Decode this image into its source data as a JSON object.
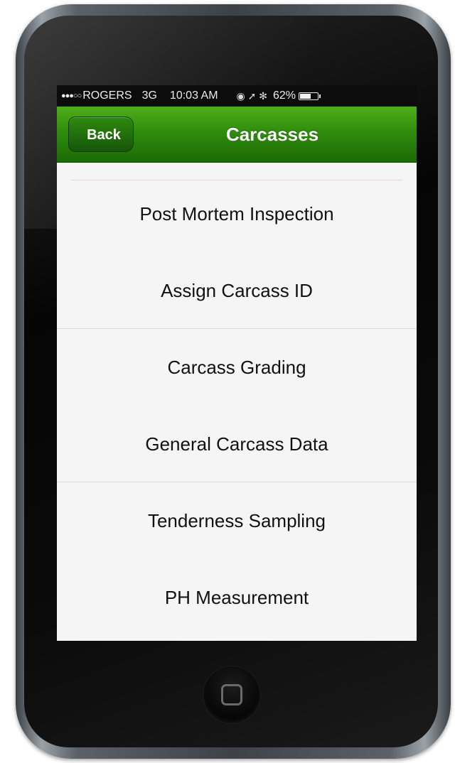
{
  "status_bar": {
    "signal": "●●●○○",
    "carrier": "ROGERS",
    "network": "3G",
    "time": "10:03 AM",
    "icons": "◉ ➚ ✻",
    "battery_pct": "62%",
    "battery_level": 0.62
  },
  "nav": {
    "back_label": "Back",
    "title": "Carcasses"
  },
  "menu": {
    "items": [
      {
        "label": "Post Mortem Inspection"
      },
      {
        "label": "Assign Carcass ID"
      },
      {
        "label": "Carcass Grading"
      },
      {
        "label": "General Carcass Data"
      },
      {
        "label": "Tenderness Sampling"
      },
      {
        "label": "PH Measurement"
      }
    ]
  },
  "colors": {
    "nav_green": "#2f8d0d",
    "status_black": "#0c0c0c",
    "list_background": "#f5f5f5"
  },
  "icons": {
    "home_button": "home-button-icon"
  }
}
